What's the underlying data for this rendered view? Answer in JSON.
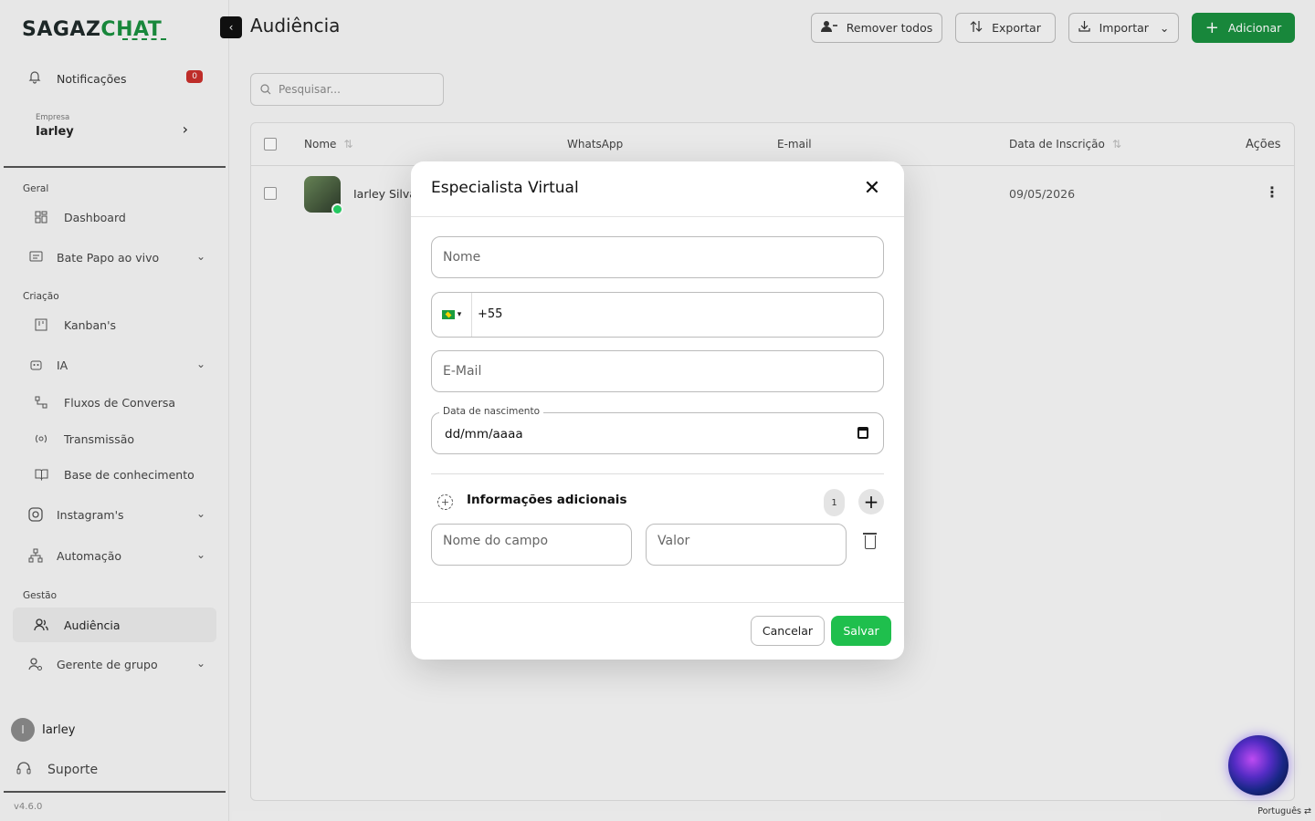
{
  "brand": {
    "logo_part1": "SAGAZ",
    "logo_part2": "CHAT"
  },
  "sidebar": {
    "notifications": {
      "label": "Notificações",
      "count": "0"
    },
    "company": {
      "caption": "Empresa",
      "name": "Iarley"
    },
    "sections": {
      "geral": "Geral",
      "criacao": "Criação",
      "gestao": "Gestão"
    },
    "items": [
      {
        "label": "Dashboard"
      },
      {
        "label": "Bate Papo ao vivo"
      },
      {
        "label": "Kanban's"
      },
      {
        "label": "IA"
      },
      {
        "label": "Fluxos de Conversa"
      },
      {
        "label": "Transmissão"
      },
      {
        "label": "Base de conhecimento"
      },
      {
        "label": "Instagram's"
      },
      {
        "label": "Automação"
      },
      {
        "label": "Audiência"
      },
      {
        "label": "Gerente de grupo"
      }
    ],
    "user": {
      "initial": "I",
      "name": "Iarley"
    },
    "support": "Suporte",
    "version": "v4.6.0"
  },
  "header": {
    "title": "Audiência",
    "buttons": {
      "remove_all": "Remover todos",
      "export": "Exportar",
      "import": "Importar",
      "add": "Adicionar"
    }
  },
  "search": {
    "placeholder": "Pesquisar..."
  },
  "table": {
    "columns": {
      "name": "Nome",
      "whatsapp": "WhatsApp",
      "email": "E-mail",
      "date": "Data de Inscrição",
      "actions": "Ações"
    },
    "rows": [
      {
        "name": "Iarley Silva",
        "date": "09/05/2026"
      }
    ]
  },
  "modal": {
    "title": "Especialista Virtual",
    "name_placeholder": "Nome",
    "phone_value": "+55",
    "email_placeholder": "E-Mail",
    "birth_label": "Data de nascimento",
    "birth_value": "dd/mm/aaaa",
    "extra_title": "Informações adicionais",
    "extra_count": "1",
    "field_name_placeholder": "Nome do campo",
    "field_value_placeholder": "Valor",
    "cancel": "Cancelar",
    "save": "Salvar"
  },
  "footer": {
    "language": "Português"
  }
}
